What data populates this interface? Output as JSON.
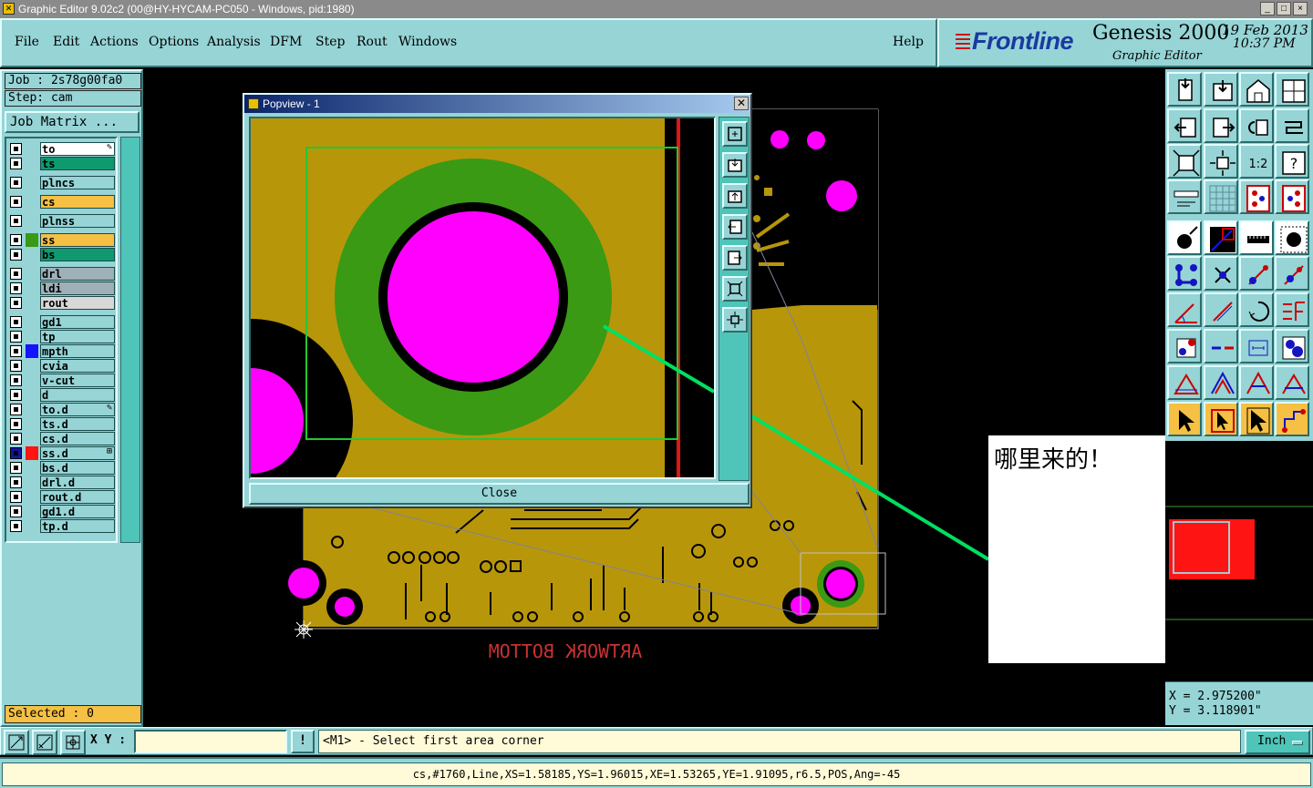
{
  "window": {
    "title": "Graphic Editor 9.02c2 (00@HY-HYCAM-PC050 - Windows, pid:1980)",
    "controls": [
      "_",
      "□",
      "×"
    ]
  },
  "menu": {
    "items": [
      {
        "label": "File"
      },
      {
        "label": "Edit"
      },
      {
        "label": "Actions"
      },
      {
        "label": "Options"
      },
      {
        "label": "Analysis"
      },
      {
        "label": "DFM"
      },
      {
        "label": "Step"
      },
      {
        "label": "Rout"
      },
      {
        "label": "Windows"
      }
    ],
    "help": "Help"
  },
  "brand": {
    "logo": "Frontline",
    "product": "Genesis 2000",
    "subtitle": "Graphic Editor",
    "date": "19 Feb 2013",
    "time": "10:37 PM"
  },
  "job": {
    "job_line": "Job : 2s78g00fa0",
    "step_line": "Step: cam",
    "matrix_button": "Job Matrix ...",
    "selected": "Selected : 0"
  },
  "layers": [
    {
      "name": "to",
      "color": "#ffffff",
      "swatch": "",
      "mark": "✎"
    },
    {
      "name": "ts",
      "color": "#0e9a6e",
      "swatch": "",
      "mark": ""
    },
    {
      "name": "plncs",
      "color": "#96d4d6",
      "swatch": "",
      "mark": ""
    },
    {
      "name": "cs",
      "color": "#f5c043",
      "swatch": "",
      "mark": ""
    },
    {
      "name": "plnss",
      "color": "#96d4d6",
      "swatch": "",
      "mark": ""
    },
    {
      "name": "ss",
      "color": "#f5c043",
      "swatch": "#3a9a14",
      "mark": ""
    },
    {
      "name": "bs",
      "color": "#0e9a6e",
      "swatch": "",
      "mark": ""
    },
    {
      "name": "drl",
      "color": "#a0b0b8",
      "swatch": "",
      "mark": ""
    },
    {
      "name": "ldi",
      "color": "#a0b0b8",
      "swatch": "",
      "mark": ""
    },
    {
      "name": "rout",
      "color": "#d8d8d8",
      "swatch": "",
      "mark": ""
    },
    {
      "name": "gd1",
      "color": "#96d4d6",
      "swatch": "",
      "mark": ""
    },
    {
      "name": "tp",
      "color": "#96d4d6",
      "swatch": "",
      "mark": ""
    },
    {
      "name": "mpth",
      "color": "#96d4d6",
      "swatch": "#1414ff",
      "mark": ""
    },
    {
      "name": "cvia",
      "color": "#96d4d6",
      "swatch": "",
      "mark": ""
    },
    {
      "name": "v-cut",
      "color": "#96d4d6",
      "swatch": "",
      "mark": ""
    },
    {
      "name": "d",
      "color": "#96d4d6",
      "swatch": "",
      "mark": ""
    },
    {
      "name": "to.d",
      "color": "#96d4d6",
      "swatch": "",
      "mark": "✎"
    },
    {
      "name": "ts.d",
      "color": "#96d4d6",
      "swatch": "",
      "mark": ""
    },
    {
      "name": "cs.d",
      "color": "#96d4d6",
      "swatch": "",
      "mark": ""
    },
    {
      "name": "ss.d",
      "color": "#96d4d6",
      "swatch": "#ff1414",
      "mark": "⊞",
      "checkbox_fill": "#1414a0"
    },
    {
      "name": "bs.d",
      "color": "#96d4d6",
      "swatch": "",
      "mark": ""
    },
    {
      "name": "drl.d",
      "color": "#96d4d6",
      "swatch": "",
      "mark": ""
    },
    {
      "name": "rout.d",
      "color": "#96d4d6",
      "swatch": "",
      "mark": ""
    },
    {
      "name": "gd1.d",
      "color": "#96d4d6",
      "swatch": "",
      "mark": ""
    },
    {
      "name": "tp.d",
      "color": "#96d4d6",
      "swatch": "",
      "mark": ""
    }
  ],
  "canvas": {
    "board_text": "ARTWORK BOTTOM",
    "colors": {
      "copper": "#b8960a",
      "pad": "#ff00ff",
      "ring": "#3a9a14",
      "outline": "#b0b0b0",
      "trace": "#00e060"
    }
  },
  "popview": {
    "title": "Popview - 1",
    "close_label": "Close"
  },
  "annotation": {
    "text": "哪里来的！"
  },
  "coords": {
    "x": "X = 2.975200\"",
    "y": "Y = 3.118901\""
  },
  "command": {
    "xy_label": "X Y :",
    "xy_value": "",
    "bang": "!",
    "prompt": "<M1> - Select first area corner",
    "unit": "Inch"
  },
  "status": {
    "text": "cs,#1760,Line,XS=1.58185,YS=1.96015,XE=1.53265,YE=1.91095,r6.5,POS,Ang=-45"
  },
  "tools": {
    "rows": [
      [
        "zoom-home",
        "zoom-in",
        "home",
        "grid-window"
      ],
      [
        "pan-left",
        "pan-right",
        "undo-view",
        "redraw"
      ],
      [
        "fit-all",
        "fit-selected",
        "scale-1-2",
        "help-query"
      ],
      [
        "measure",
        "grid",
        "snap-points",
        "snap-points-alt"
      ],
      [
        "pad-select",
        "highlight",
        "ruler",
        "pad-round"
      ],
      [
        "connect-net",
        "delete-x",
        "move-point",
        "add-point"
      ],
      [
        "angle-line",
        "line-tool",
        "rotate",
        "text-tool"
      ],
      [
        "move-node",
        "split-line",
        "dimension",
        "pad-group"
      ],
      [
        "triangle-a",
        "triangle-b",
        "triangle-c",
        "triangle-d"
      ],
      [
        "pointer",
        "pointer-box",
        "pointer-alt",
        "route-tool"
      ]
    ]
  }
}
